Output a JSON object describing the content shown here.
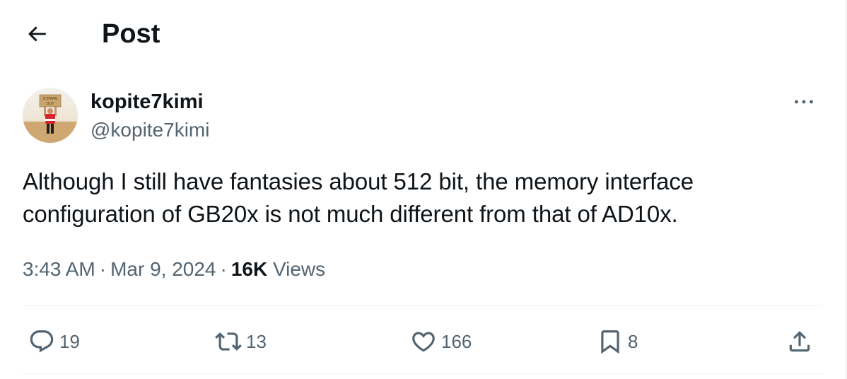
{
  "header": {
    "title": "Post",
    "back_icon": "arrow-left-icon"
  },
  "author": {
    "display_name": "kopite7kimi",
    "handle": "@kopite7kimi",
    "avatar": {
      "sign_line1": "ICEMAN",
      "sign_line2": "OUT"
    },
    "more_icon": "ellipsis-icon"
  },
  "tweet": {
    "text_lines": [
      "Although I still have fantasies about 512 bit, the memory interface",
      "configuration of GB20x is not much different from that of AD10x."
    ]
  },
  "meta": {
    "time": "3:43 AM",
    "separator": "·",
    "date": "Mar 9, 2024",
    "views_count": "16K",
    "views_label": "Views"
  },
  "actions": {
    "replies": {
      "icon": "reply-icon",
      "count": "19"
    },
    "reposts": {
      "icon": "repost-icon",
      "count": "13"
    },
    "likes": {
      "icon": "heart-icon",
      "count": "166"
    },
    "bookmarks": {
      "icon": "bookmark-icon",
      "count": "8"
    },
    "share": {
      "icon": "share-icon"
    }
  },
  "colors": {
    "primary_text": "#0f1419",
    "secondary_text": "#536471",
    "divider": "#eff3f4"
  }
}
